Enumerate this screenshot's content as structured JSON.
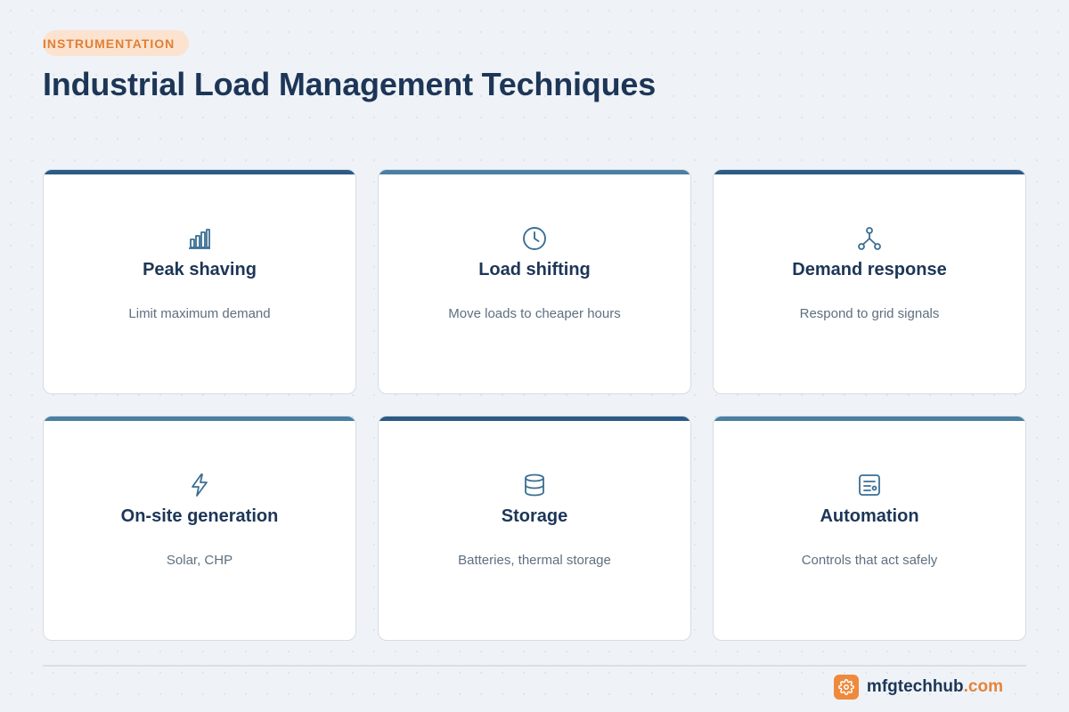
{
  "header": {
    "badge": "INSTRUMENTATION",
    "title": "Industrial Load Management Techniques"
  },
  "colors": {
    "accent_orange": "#e07f36",
    "badge_bg": "#fbe3cf",
    "title_navy": "#1d3657",
    "bar_dark": "#2d5a86",
    "bar_light": "#4b7fa3",
    "icon_color": "#3a6f93"
  },
  "cards": [
    {
      "title": "Peak shaving",
      "desc": "Limit maximum demand",
      "icon": "bar-chart-icon",
      "bar_color": "#2d5a86"
    },
    {
      "title": "Load shifting",
      "desc": "Move loads to cheaper hours",
      "icon": "clock-icon",
      "bar_color": "#4b7fa3"
    },
    {
      "title": "Demand response",
      "desc": "Respond to grid signals",
      "icon": "network-icon",
      "bar_color": "#2d5a86"
    },
    {
      "title": "On-site generation",
      "desc": "Solar, CHP",
      "icon": "lightning-icon",
      "bar_color": "#4b7fa3"
    },
    {
      "title": "Storage",
      "desc": "Batteries, thermal storage",
      "icon": "database-icon",
      "bar_color": "#2d5a86"
    },
    {
      "title": "Automation",
      "desc": "Controls that act safely",
      "icon": "control-panel-icon",
      "bar_color": "#4b7fa3"
    }
  ],
  "footer": {
    "brand_name": "mfgtechhub",
    "brand_tld": ".com",
    "logo_icon": "gear-icon"
  }
}
